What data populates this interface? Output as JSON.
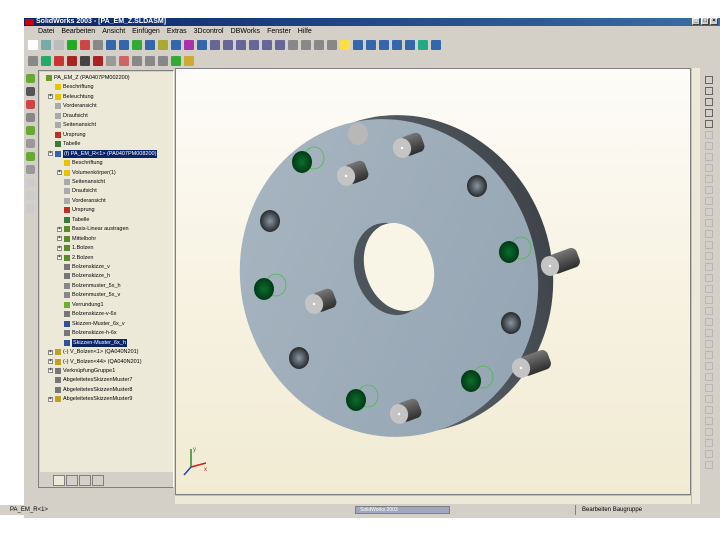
{
  "title": "SolidWorks 2003 - [PA_EM_Z.SLDASM]",
  "menu": [
    "Datei",
    "Bearbeiten",
    "Ansicht",
    "Einfügen",
    "Extras",
    "3Dcontrol",
    "DBWorks",
    "Fenster",
    "Hilfe"
  ],
  "tree": [
    {
      "label": "PA_EM_Z (PA0407PM002200)",
      "indent": 0,
      "exp": false,
      "icon": "assembly-icon",
      "color": "#6a9a2a"
    },
    {
      "label": "Beschriftung",
      "indent": 1,
      "exp": false,
      "icon": "annotation-icon",
      "color": "#e8c400"
    },
    {
      "label": "Beleuchtung",
      "indent": 1,
      "exp": true,
      "icon": "lighting-icon",
      "color": "#e8c400"
    },
    {
      "label": "Vorderansicht",
      "indent": 1,
      "exp": false,
      "icon": "plane-icon",
      "color": "#aaa"
    },
    {
      "label": "Draufsicht",
      "indent": 1,
      "exp": false,
      "icon": "plane-icon",
      "color": "#aaa"
    },
    {
      "label": "Seitenansicht",
      "indent": 1,
      "exp": false,
      "icon": "plane-icon",
      "color": "#aaa"
    },
    {
      "label": "Ursprung",
      "indent": 1,
      "exp": false,
      "icon": "origin-icon",
      "color": "#c03020"
    },
    {
      "label": "Tabelle",
      "indent": 1,
      "exp": false,
      "icon": "table-icon",
      "color": "#3a7a3a"
    },
    {
      "label": "(f) PA_EM_R<1> (PA0407PM008200)",
      "indent": 1,
      "exp": true,
      "icon": "part-icon",
      "color": "#3060c0",
      "sel": true
    },
    {
      "label": "Beschriftung",
      "indent": 2,
      "exp": false,
      "icon": "annotation-icon",
      "color": "#e8c400"
    },
    {
      "label": "Volumenkörper(1)",
      "indent": 2,
      "exp": true,
      "icon": "solid-bodies-icon",
      "color": "#e8c400"
    },
    {
      "label": "Seitenansicht",
      "indent": 2,
      "exp": false,
      "icon": "plane-icon",
      "color": "#aaa"
    },
    {
      "label": "Draufsicht",
      "indent": 2,
      "exp": false,
      "icon": "plane-icon",
      "color": "#aaa"
    },
    {
      "label": "Vorderansicht",
      "indent": 2,
      "exp": false,
      "icon": "plane-icon",
      "color": "#aaa"
    },
    {
      "label": "Ursprung",
      "indent": 2,
      "exp": false,
      "icon": "origin-icon",
      "color": "#c03020"
    },
    {
      "label": "Tabelle",
      "indent": 2,
      "exp": false,
      "icon": "table-icon",
      "color": "#3a7a3a"
    },
    {
      "label": "Basis-Linear austragen",
      "indent": 2,
      "exp": true,
      "icon": "extrude-icon",
      "color": "#5a8a2a"
    },
    {
      "label": "Mittelbohr",
      "indent": 2,
      "exp": true,
      "icon": "extrude-icon",
      "color": "#5a8a2a"
    },
    {
      "label": "1.Bolzen",
      "indent": 2,
      "exp": true,
      "icon": "extrude-icon",
      "color": "#5a8a2a"
    },
    {
      "label": "2.Bolzen",
      "indent": 2,
      "exp": true,
      "icon": "extrude-icon",
      "color": "#5a8a2a"
    },
    {
      "label": "Bolzenskizze_v",
      "indent": 2,
      "exp": false,
      "icon": "sketch-icon",
      "color": "#777"
    },
    {
      "label": "Bolzenskizze_h",
      "indent": 2,
      "exp": false,
      "icon": "sketch-icon",
      "color": "#777"
    },
    {
      "label": "Bolzenmuster_5x_h",
      "indent": 2,
      "exp": false,
      "icon": "pattern-icon",
      "color": "#888"
    },
    {
      "label": "Bolzenmuster_5x_v",
      "indent": 2,
      "exp": false,
      "icon": "pattern-icon",
      "color": "#888"
    },
    {
      "label": "Verrundung1",
      "indent": 2,
      "exp": false,
      "icon": "fillet-icon",
      "color": "#6ab02a"
    },
    {
      "label": "Bolzenskizze-v-6x",
      "indent": 2,
      "exp": false,
      "icon": "sketch-icon",
      "color": "#777"
    },
    {
      "label": "Skizzen-Muster_6x_v",
      "indent": 2,
      "exp": false,
      "icon": "sketch-pattern-icon",
      "color": "#3050a0"
    },
    {
      "label": "Bolzenskizze-h-6x",
      "indent": 2,
      "exp": false,
      "icon": "sketch-icon",
      "color": "#777"
    },
    {
      "label": "Skizzen-Muster_6x_h",
      "indent": 2,
      "exp": false,
      "icon": "sketch-pattern-icon",
      "color": "#3050a0",
      "sel": true
    },
    {
      "label": "(-) V_Bolzen<1> (QA040N201)",
      "indent": 1,
      "exp": true,
      "icon": "part-icon",
      "color": "#c0a020"
    },
    {
      "label": "(-) V_Bolzen<44> (QA040N201)",
      "indent": 1,
      "exp": true,
      "icon": "part-icon",
      "color": "#c0a020"
    },
    {
      "label": "VerknüpfungGruppe1",
      "indent": 1,
      "exp": true,
      "icon": "mates-icon",
      "color": "#777"
    },
    {
      "label": "AbgeleitetesSkizzenMuster7",
      "indent": 1,
      "exp": false,
      "icon": "derived-pattern-icon",
      "color": "#777"
    },
    {
      "label": "AbgeleitetesSkizzenMuster8",
      "indent": 1,
      "exp": false,
      "icon": "derived-pattern-icon",
      "color": "#777"
    },
    {
      "label": "AbgeleitetesSkizzenMuster9",
      "indent": 1,
      "exp": true,
      "icon": "derived-pattern-icon",
      "color": "#c0a020"
    }
  ],
  "status": {
    "left": "PA_EM_R<1>",
    "right": "Bearbeiten Baugruppe",
    "task": "SolidWorks 2003"
  },
  "axes": {
    "x": "x",
    "y": "y"
  }
}
